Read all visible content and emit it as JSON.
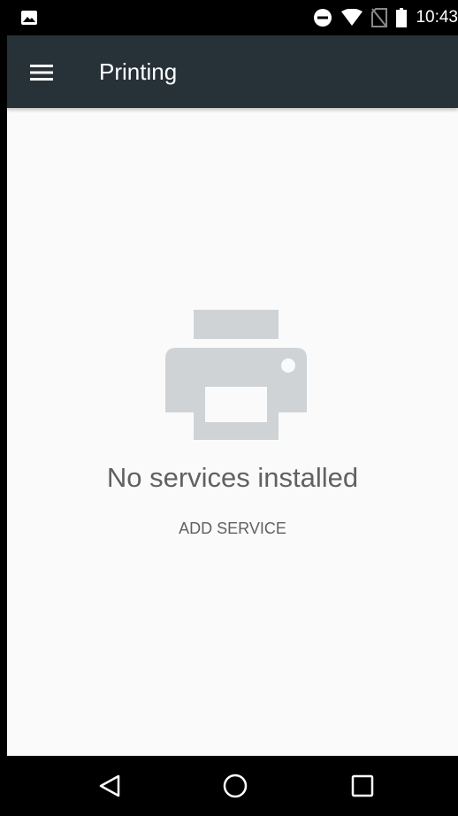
{
  "status_bar": {
    "time": "10:43",
    "icons": [
      "gallery-icon",
      "do-not-disturb-icon",
      "wifi-icon",
      "no-sim-icon",
      "battery-icon"
    ]
  },
  "app_bar": {
    "title": "Printing",
    "menu_icon": "hamburger-menu-icon",
    "background_color": "#263238"
  },
  "empty_state": {
    "icon": "printer-icon",
    "message": "No services installed",
    "action_label": "ADD SERVICE"
  },
  "nav_bar": {
    "buttons": [
      "back-icon",
      "home-icon",
      "recents-icon"
    ]
  }
}
